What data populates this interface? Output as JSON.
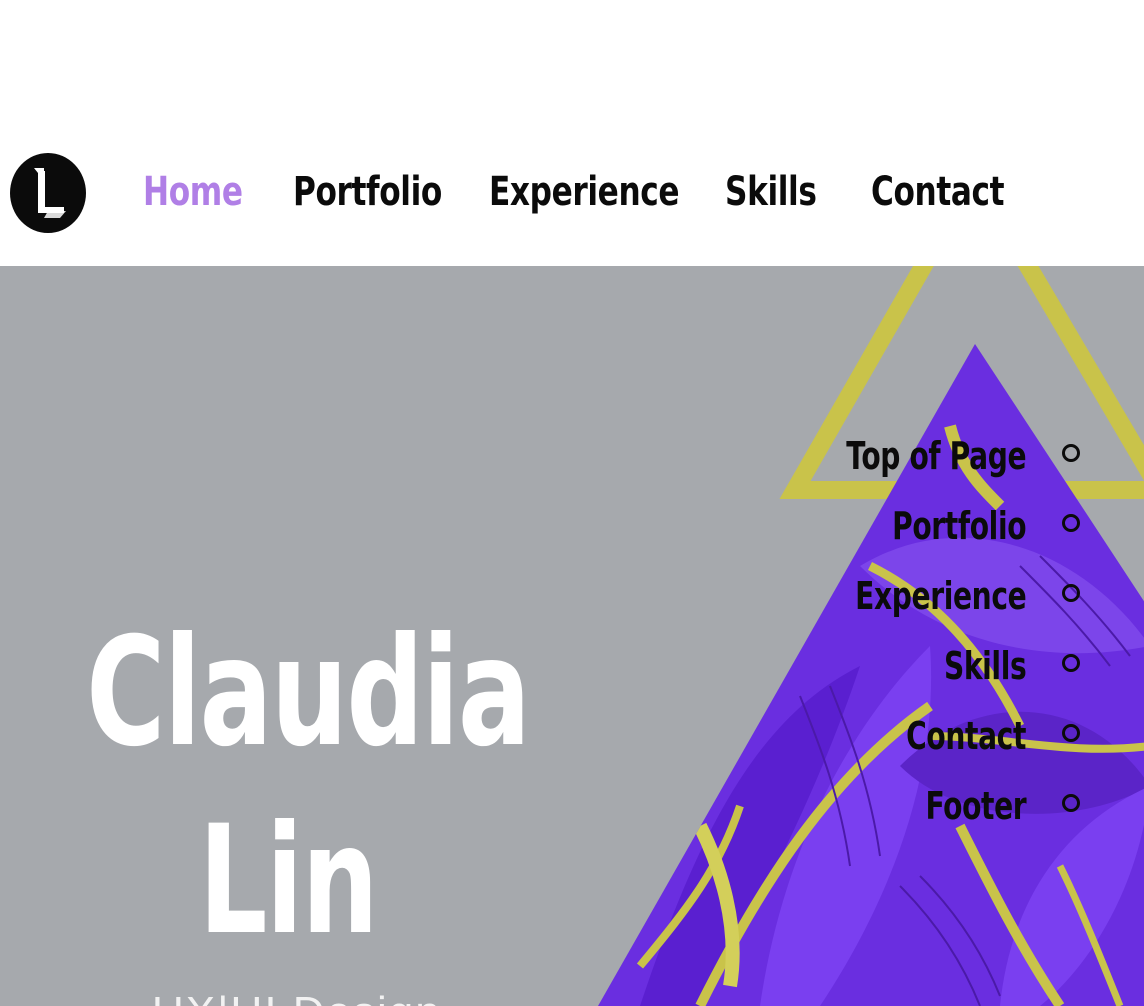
{
  "colors": {
    "accent": "#b07fe6",
    "nav_text": "#0b0b0b",
    "hero_background": "#a6a9ad",
    "triangle_fill": "#6a2ee0",
    "triangle_outline": "#c9c34a",
    "name_text": "#ffffff"
  },
  "header": {
    "logo_icon": "letter-l-logo-icon",
    "nav": [
      {
        "label": "Home",
        "active": true
      },
      {
        "label": "Portfolio",
        "active": false
      },
      {
        "label": "Experience",
        "active": false
      },
      {
        "label": "Skills",
        "active": false
      },
      {
        "label": "Contact",
        "active": false
      }
    ]
  },
  "hero": {
    "first_name": "Claudia",
    "last_name": "Lin",
    "role": "UX|UI Design"
  },
  "anchor_menu": {
    "items": [
      {
        "label": "Top of Page"
      },
      {
        "label": "Portfolio"
      },
      {
        "label": "Experience"
      },
      {
        "label": "Skills"
      },
      {
        "label": "Contact"
      },
      {
        "label": "Footer"
      }
    ]
  }
}
